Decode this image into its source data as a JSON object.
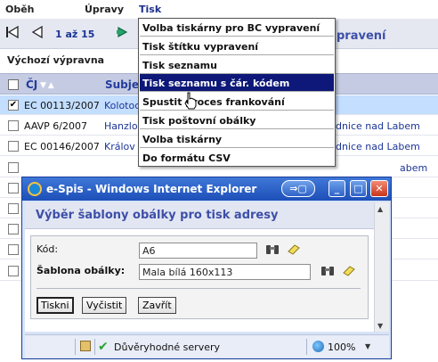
{
  "menubar": {
    "items": [
      "Oběh",
      "Úpravy",
      "Tisk"
    ]
  },
  "pager": {
    "text": "1 až 15",
    "title_fragment": "pravení"
  },
  "section": {
    "label": "Výchozí výpravna"
  },
  "table": {
    "headers": {
      "cj": "ČJ",
      "subject": "Subje"
    },
    "rows": [
      {
        "checked": true,
        "cj": "EC 00113/2007",
        "subject": "Kolotoc",
        "extra": ""
      },
      {
        "checked": false,
        "cj": "AAVP 6/2007",
        "subject": "Hanzlo",
        "extra": "udnice nad Labem"
      },
      {
        "checked": false,
        "cj": "EC 00146/2007",
        "subject": "Králov",
        "extra": "udnice nad Labem"
      },
      {
        "checked": false,
        "cj": "",
        "subject": "",
        "extra": "abem"
      },
      {
        "checked": false,
        "cj": "",
        "subject": "",
        "extra": ""
      },
      {
        "checked": false,
        "cj": "",
        "subject": "",
        "extra": ""
      },
      {
        "checked": false,
        "cj": "",
        "subject": "",
        "extra": ""
      },
      {
        "checked": false,
        "cj": "",
        "subject": "",
        "extra": ""
      },
      {
        "checked": false,
        "cj": "",
        "subject": "",
        "extra": ""
      }
    ]
  },
  "dropdown": {
    "items": [
      "Volba tiskárny pro BC vypravení",
      "Tisk štítku vypravení",
      "Tisk seznamu",
      "Tisk seznamu s čár. kódem",
      "Spustit proces frankování",
      "Tisk poštovní obálky",
      "Volba tiskárny",
      "Do formátu CSV"
    ],
    "highlighted": "Tisk seznamu s čár. kódem"
  },
  "popup": {
    "window_title": "e-Spis - Windows Internet Explorer",
    "heading": "Výběr šablony obálky pro tisk adresy",
    "fields": {
      "kod_label": "Kód:",
      "kod_value": "A6",
      "sablona_label": "Šablona obálky:",
      "sablona_value": "Mala bílá 160x113"
    },
    "buttons": {
      "print": "Tiskni",
      "clear": "Vyčistit",
      "close": "Zavřít"
    },
    "status": {
      "zone": "Důvěryhodné servery",
      "zoom": "100%"
    }
  },
  "colors": {
    "accent": "#1c3597",
    "menu_highlight": "#0d1878",
    "selected_row": "#c3deff",
    "titlebar": "#1d4fb8"
  }
}
